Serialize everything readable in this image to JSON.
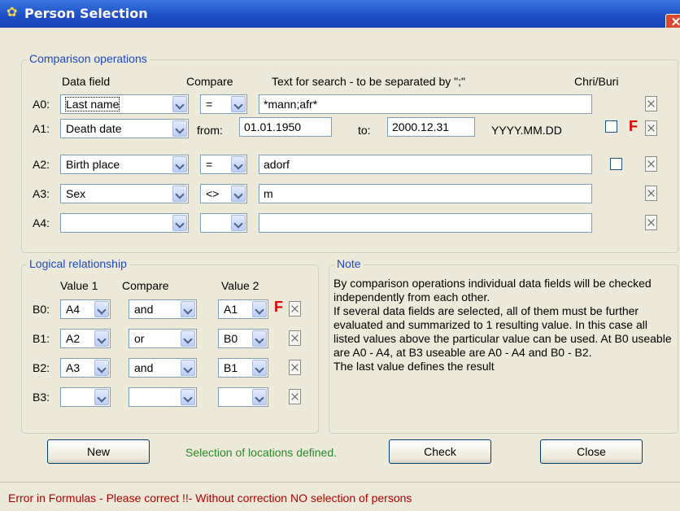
{
  "window": {
    "title": "Person Selection",
    "close_glyph": "✕"
  },
  "comparison": {
    "title": "Comparison operations",
    "headers": {
      "data_field": "Data field",
      "compare": "Compare",
      "text": "Text for search - to be separated by \";\"",
      "chri": "Chri/Buri"
    },
    "rows": [
      {
        "label": "A0:",
        "field": "Last name",
        "op": "=",
        "value": "*mann;afr*",
        "checkbox": false,
        "flag": ""
      },
      {
        "label": "A1:",
        "field": "Death date",
        "from_label": "from:",
        "from": "01.01.1950",
        "to_label": "to:",
        "to": "2000.12.31",
        "format": "YYYY.MM.DD",
        "checkbox": true,
        "flag": "F"
      },
      {
        "label": "A2:",
        "field": "Birth place",
        "op": "=",
        "value": "adorf",
        "checkbox": true,
        "flag": ""
      },
      {
        "label": "A3:",
        "field": "Sex",
        "op": "<>",
        "value": "m",
        "checkbox": false,
        "flag": ""
      },
      {
        "label": "A4:",
        "field": "",
        "op": "",
        "value": "",
        "checkbox": false,
        "flag": ""
      }
    ]
  },
  "logical": {
    "title": "Logical relationship",
    "headers": {
      "value1": "Value 1",
      "compare": "Compare",
      "value2": "Value 2"
    },
    "rows": [
      {
        "label": "B0:",
        "v1": "A4",
        "op": "and",
        "v2": "A1",
        "flag": "F"
      },
      {
        "label": "B1:",
        "v1": "A2",
        "op": "or",
        "v2": "B0",
        "flag": ""
      },
      {
        "label": "B2:",
        "v1": "A3",
        "op": "and",
        "v2": "B1",
        "flag": ""
      },
      {
        "label": "B3:",
        "v1": "",
        "op": "",
        "v2": "",
        "flag": ""
      }
    ]
  },
  "note": {
    "title": "Note",
    "text": "By comparison operations individual data fields will be checked independently from each other.\nIf several data fields are selected, all of them must be further evaluated and summarized to 1 resulting value. In this case all listed values above the particular value can be used. At B0 useable are A0 - A4, at B3 useable are A0 - A4 and B0 - B2.\nThe last value defines the result"
  },
  "buttons": {
    "new": "New",
    "check": "Check",
    "close": "Close"
  },
  "status": "Selection of locations defined.",
  "error": "Error in Formulas - Please correct !!- Without correction NO selection of persons",
  "colors": {
    "accent": "#1c48c8",
    "error": "#b00000",
    "flag": "#e00000",
    "status": "#2a8a2a"
  }
}
